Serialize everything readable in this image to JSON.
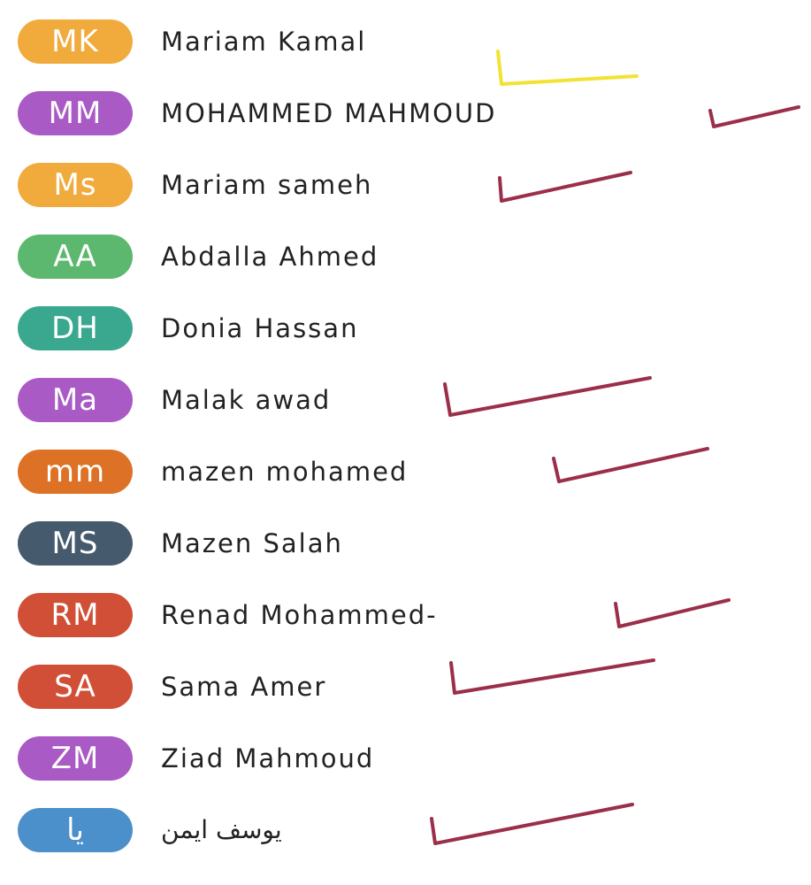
{
  "colors": {
    "check_red": "#9b2f4a",
    "check_yellow": "#f3e234",
    "text": "#222222",
    "background": "#ffffff"
  },
  "participants": [
    {
      "initials": "MK",
      "name": "Mariam Kamal",
      "avatar_color": "#f0ab3c",
      "check": "yellow"
    },
    {
      "initials": "MM",
      "name": "MOHAMMED MAHMOUD",
      "avatar_color": "#a95ac4",
      "check": "red"
    },
    {
      "initials": "Ms",
      "name": "Mariam sameh",
      "avatar_color": "#f0ab3c",
      "check": "red"
    },
    {
      "initials": "AA",
      "name": "Abdalla Ahmed",
      "avatar_color": "#5cb86e",
      "check": "none"
    },
    {
      "initials": "DH",
      "name": "Donia Hassan",
      "avatar_color": "#3aa88f",
      "check": "none"
    },
    {
      "initials": "Ma",
      "name": "Malak awad",
      "avatar_color": "#a95ac4",
      "check": "red"
    },
    {
      "initials": "mm",
      "name": "mazen mohamed",
      "avatar_color": "#dd7226",
      "check": "red"
    },
    {
      "initials": "MS",
      "name": "Mazen Salah",
      "avatar_color": "#465a6d",
      "check": "none"
    },
    {
      "initials": "RM",
      "name": "Renad Mohammed-",
      "avatar_color": "#d14f36",
      "check": "red"
    },
    {
      "initials": "SA",
      "name": "Sama Amer",
      "avatar_color": "#d14f36",
      "check": "red"
    },
    {
      "initials": "ZM",
      "name": "Ziad Mahmoud",
      "avatar_color": "#a95ac4",
      "check": "none"
    },
    {
      "initials": "يا",
      "name": "يوسف ايمن",
      "avatar_color": "#4b8fcb",
      "check": "red"
    }
  ]
}
